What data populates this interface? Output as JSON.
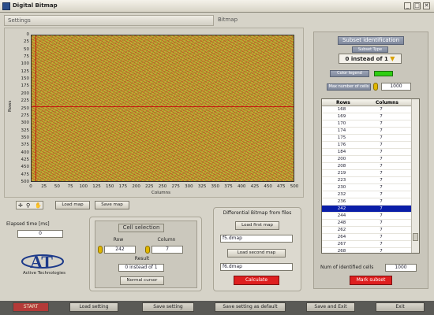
{
  "window": {
    "title": "Digital Bitmap",
    "min": "_",
    "max": "□",
    "close": "✕"
  },
  "headers": {
    "settings": "Settings",
    "bitmap": "Bitmap"
  },
  "plot": {
    "ylabel": "Rows",
    "xlabel": "Columns",
    "yticks": [
      "0",
      "25",
      "50",
      "75",
      "100",
      "125",
      "150",
      "175",
      "200",
      "225",
      "250",
      "275",
      "300",
      "325",
      "350",
      "375",
      "400",
      "425",
      "450",
      "475",
      "500"
    ],
    "xticks": [
      "0",
      "25",
      "50",
      "75",
      "100",
      "125",
      "150",
      "175",
      "200",
      "225",
      "250",
      "275",
      "300",
      "325",
      "350",
      "375",
      "400",
      "425",
      "450",
      "475",
      "500"
    ],
    "selected_row_value": 242,
    "selected_column_value": 7,
    "colors": {
      "primary": "#c5160e",
      "secondary": "#b6a83a"
    }
  },
  "plot_buttons": {
    "load_map": "Load map",
    "save_map": "Save map"
  },
  "elapsed": {
    "label": "Elapsed time [ms]",
    "value": "0"
  },
  "cell_selection": {
    "title": "Cell selection",
    "row_label": "Row",
    "row_value": "242",
    "column_label": "Column",
    "column_value": "7",
    "result_label": "Result",
    "result_value": "0 instead of 1",
    "normal_cursor": "Normal cursor"
  },
  "diff": {
    "title": "Differential Bitmap from files",
    "load_first": "Load first map",
    "first_file": "f5.dmap",
    "load_second": "Load second  map",
    "second_file": "f6.dmap",
    "calculate": "Calculate"
  },
  "subset": {
    "title": "Subset identification",
    "type_label": "Subset Type",
    "type_value": "0 instead of 1",
    "legend_label": "Color legend",
    "legend_color": "#2fce12",
    "max_label": "Max number of cells",
    "max_value": "1000",
    "table_headers": [
      "Rows",
      "Columns"
    ],
    "rows": [
      [
        "168",
        "7"
      ],
      [
        "169",
        "7"
      ],
      [
        "170",
        "7"
      ],
      [
        "174",
        "7"
      ],
      [
        "175",
        "7"
      ],
      [
        "176",
        "7"
      ],
      [
        "184",
        "7"
      ],
      [
        "200",
        "7"
      ],
      [
        "208",
        "7"
      ],
      [
        "219",
        "7"
      ],
      [
        "223",
        "7"
      ],
      [
        "230",
        "7"
      ],
      [
        "232",
        "7"
      ],
      [
        "236",
        "7"
      ],
      [
        "242",
        "7"
      ],
      [
        "244",
        "7"
      ],
      [
        "248",
        "7"
      ],
      [
        "262",
        "7"
      ],
      [
        "264",
        "7"
      ],
      [
        "267",
        "7"
      ],
      [
        "268",
        "7"
      ]
    ],
    "selected_row": 14,
    "num_label": "Num of identified cells",
    "num_value": "1000",
    "mark": "Mark subset"
  },
  "logo": {
    "letters": "AT",
    "name": "Active Technologies"
  },
  "bottom": {
    "start": "START",
    "load_setting": "Load setting",
    "save_setting": "Save setting",
    "save_default": "Save setting as default",
    "save_exit": "Save and Exit",
    "exit": "Exit"
  }
}
